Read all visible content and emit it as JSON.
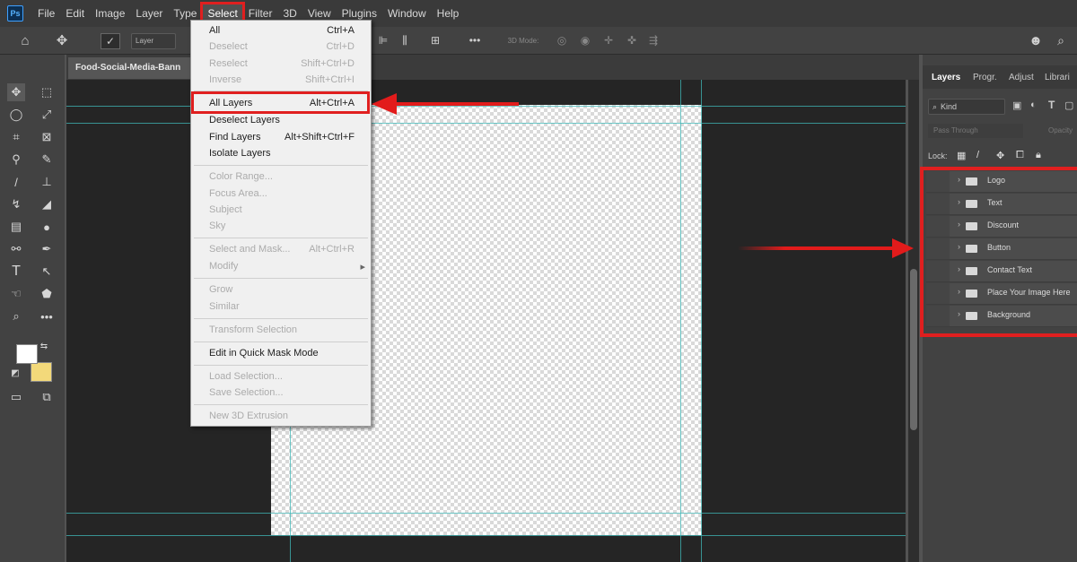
{
  "app": {
    "logo_text": "Ps",
    "menus": [
      "File",
      "Edit",
      "Image",
      "Layer",
      "Type",
      "Select",
      "Filter",
      "3D",
      "View",
      "Plugins",
      "Window",
      "Help"
    ],
    "active_menu": "Select"
  },
  "options_bar": {
    "layer_dropdown": "Layer",
    "mode_3d": "3D Mode:"
  },
  "document": {
    "tab_title": "Food-Social-Media-Bann"
  },
  "select_menu": {
    "items": [
      {
        "label": "All",
        "shortcut": "Ctrl+A",
        "enabled": true
      },
      {
        "label": "Deselect",
        "shortcut": "Ctrl+D",
        "enabled": false
      },
      {
        "label": "Reselect",
        "shortcut": "Shift+Ctrl+D",
        "enabled": false
      },
      {
        "label": "Inverse",
        "shortcut": "Shift+Ctrl+I",
        "enabled": false
      },
      {
        "label": "All Layers",
        "shortcut": "Alt+Ctrl+A",
        "enabled": true
      },
      {
        "label": "Deselect Layers",
        "shortcut": "",
        "enabled": true
      },
      {
        "label": "Find Layers",
        "shortcut": "Alt+Shift+Ctrl+F",
        "enabled": true
      },
      {
        "label": "Isolate Layers",
        "shortcut": "",
        "enabled": true
      },
      {
        "label": "Color Range...",
        "shortcut": "",
        "enabled": false
      },
      {
        "label": "Focus Area...",
        "shortcut": "",
        "enabled": false
      },
      {
        "label": "Subject",
        "shortcut": "",
        "enabled": false
      },
      {
        "label": "Sky",
        "shortcut": "",
        "enabled": false
      },
      {
        "label": "Select and Mask...",
        "shortcut": "Alt+Ctrl+R",
        "enabled": false
      },
      {
        "label": "Modify",
        "shortcut": "",
        "enabled": false
      },
      {
        "label": "Grow",
        "shortcut": "",
        "enabled": false
      },
      {
        "label": "Similar",
        "shortcut": "",
        "enabled": false
      },
      {
        "label": "Transform Selection",
        "shortcut": "",
        "enabled": false
      },
      {
        "label": "Edit in Quick Mask Mode",
        "shortcut": "",
        "enabled": true
      },
      {
        "label": "Load Selection...",
        "shortcut": "",
        "enabled": false
      },
      {
        "label": "Save Selection...",
        "shortcut": "",
        "enabled": false
      },
      {
        "label": "New 3D Extrusion",
        "shortcut": "",
        "enabled": false
      }
    ]
  },
  "layers_panel": {
    "tabs": [
      "Layers",
      "Progr.",
      "Adjust",
      "Librari"
    ],
    "kind_label": "Kind",
    "blend_mode": "Pass Through",
    "opacity_label": "Opacity",
    "lock_label": "Lock:",
    "layers": [
      "Logo",
      "Text",
      "Discount",
      "Button",
      "Contact Text",
      "Place Your Image Here",
      "Background"
    ]
  },
  "colors": {
    "highlight_red": "#e01f1f",
    "canvas_guides": "#3fb8b8",
    "background_swatch": "#f3d97a"
  }
}
